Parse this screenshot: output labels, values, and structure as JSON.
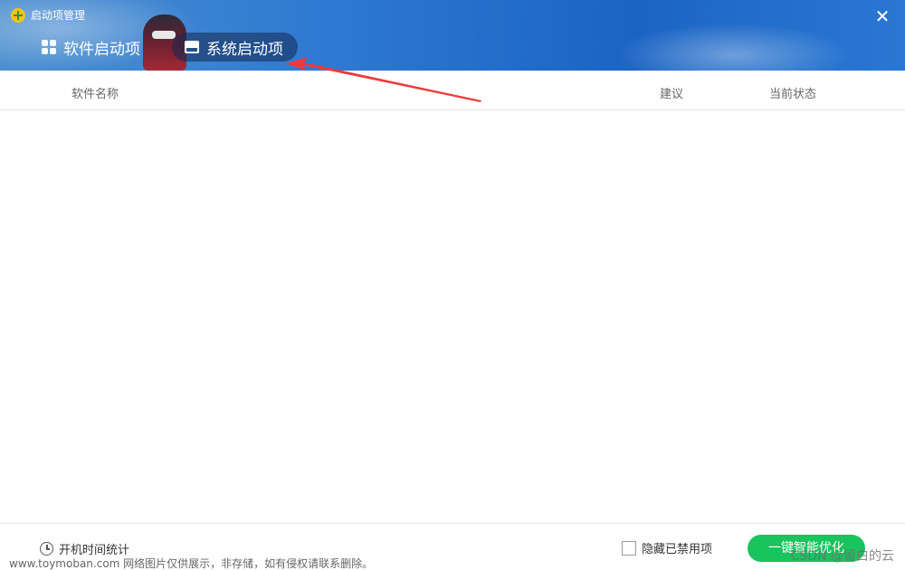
{
  "window": {
    "title": "启动项管理",
    "close_symbol": "✕"
  },
  "tabs": [
    {
      "label": "软件启动项",
      "icon": "grid-icon",
      "selected": false
    },
    {
      "label": "系统启动项",
      "icon": "panel-icon",
      "selected": true
    }
  ],
  "table": {
    "columns": [
      "软件名称",
      "建议",
      "当前状态"
    ],
    "rows": []
  },
  "footer": {
    "boot_stats_label": "开机时间统计",
    "hide_disabled_label": "隐藏已禁用项",
    "hide_disabled_checked": false,
    "optimize_label": "一键智能优化"
  },
  "watermarks": {
    "left": "www.toymoban.com 网络图片仅供展示，非存储，如有侵权请联系删除。",
    "right": "CSDN @留白的云"
  },
  "colors": {
    "header_blue": "#2f7ad2",
    "optimize_green": "#19c35e",
    "arrow_red": "#f03a3a"
  }
}
